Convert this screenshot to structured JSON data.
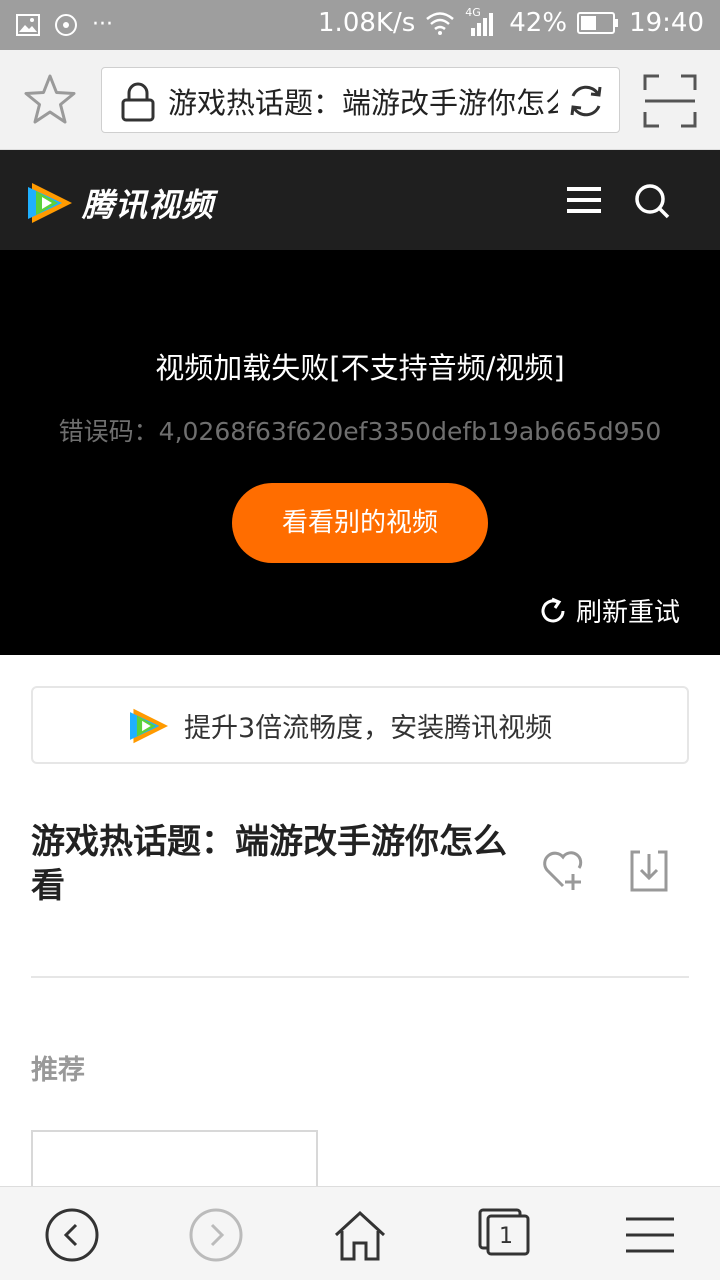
{
  "status_bar": {
    "network_speed": "1.08K/s",
    "network_type": "4G",
    "battery": "42%",
    "time": "19:40",
    "overflow": "···"
  },
  "browser": {
    "url_text": "游戏热话题：端游改手游你怎么看"
  },
  "site": {
    "logo_text": "腾讯视频"
  },
  "player": {
    "error_message": "视频加载失败[不支持音频/视频]",
    "error_code": "错误码：4,0268f63f620ef3350defb19ab665d950",
    "other_videos_button": "看看别的视频",
    "refresh_label": "刷新重试"
  },
  "install_banner": {
    "text": "提升3倍流畅度，安装腾讯视频"
  },
  "video": {
    "title": "游戏热话题：端游改手游你怎么看"
  },
  "recommend": {
    "label": "推荐"
  },
  "bottom_nav": {
    "tab_count": "1"
  },
  "colors": {
    "accent": "#ff6d00",
    "header_bg": "#1f1f1f",
    "status_bar_bg": "#9e9e9e"
  }
}
